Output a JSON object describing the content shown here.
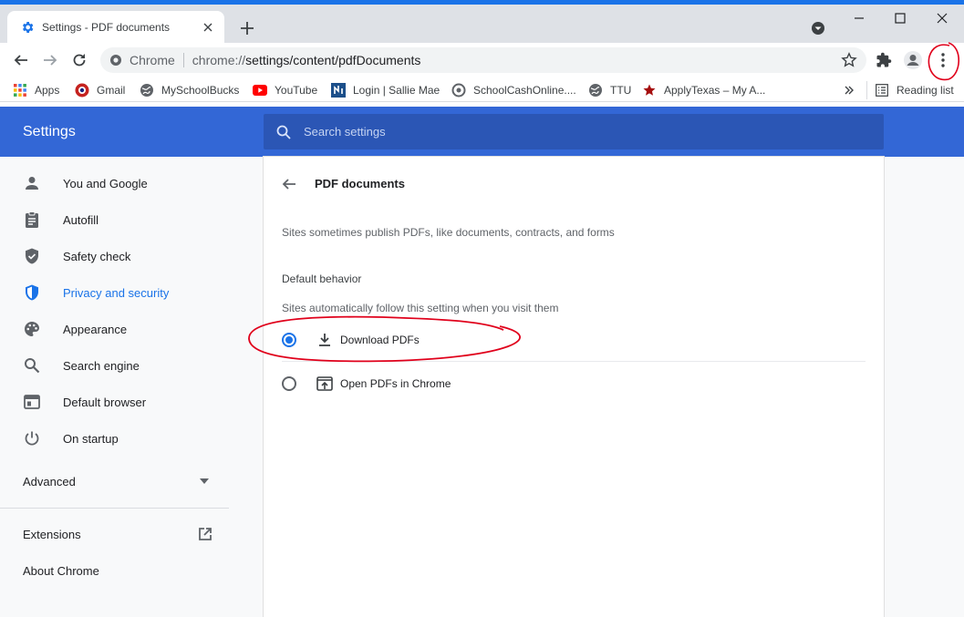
{
  "browser": {
    "tab_title": "Settings - PDF documents",
    "site_chip": "Chrome",
    "url_scheme": "chrome://",
    "url_rest": "settings/content/pdfDocuments"
  },
  "bookmarks": {
    "apps": "Apps",
    "items": [
      {
        "label": "Gmail",
        "icon": "gmail-icon"
      },
      {
        "label": "MySchoolBucks",
        "icon": "globe-icon"
      },
      {
        "label": "YouTube",
        "icon": "youtube-icon"
      },
      {
        "label": "Login | Sallie Mae",
        "icon": "sallie-mae-icon"
      },
      {
        "label": "SchoolCashOnline....",
        "icon": "schoolcash-icon"
      },
      {
        "label": "TTU",
        "icon": "globe-icon"
      },
      {
        "label": "ApplyTexas – My A...",
        "icon": "star-icon"
      }
    ],
    "reading_list": "Reading list"
  },
  "settings": {
    "title": "Settings",
    "search_placeholder": "Search settings"
  },
  "sidebar": {
    "items": [
      {
        "label": "You and Google",
        "icon": "person-icon"
      },
      {
        "label": "Autofill",
        "icon": "clipboard-icon"
      },
      {
        "label": "Safety check",
        "icon": "shield-check-icon"
      },
      {
        "label": "Privacy and security",
        "icon": "shield-icon"
      },
      {
        "label": "Appearance",
        "icon": "palette-icon"
      },
      {
        "label": "Search engine",
        "icon": "search-icon"
      },
      {
        "label": "Default browser",
        "icon": "browser-icon"
      },
      {
        "label": "On startup",
        "icon": "power-icon"
      }
    ],
    "active_index": 3,
    "advanced": "Advanced",
    "extensions": "Extensions",
    "about": "About Chrome"
  },
  "page": {
    "title": "PDF documents",
    "description": "Sites sometimes publish PDFs, like documents, contracts, and forms",
    "section_heading": "Default behavior",
    "section_sub": "Sites automatically follow this setting when you visit them",
    "options": [
      {
        "label": "Download PDFs",
        "icon": "download-icon",
        "checked": true
      },
      {
        "label": "Open PDFs in Chrome",
        "icon": "open-in-browser-icon",
        "checked": false
      }
    ]
  },
  "colors": {
    "accent": "#1a73e8",
    "header": "#3367d6",
    "annotation": "#e0001b"
  }
}
